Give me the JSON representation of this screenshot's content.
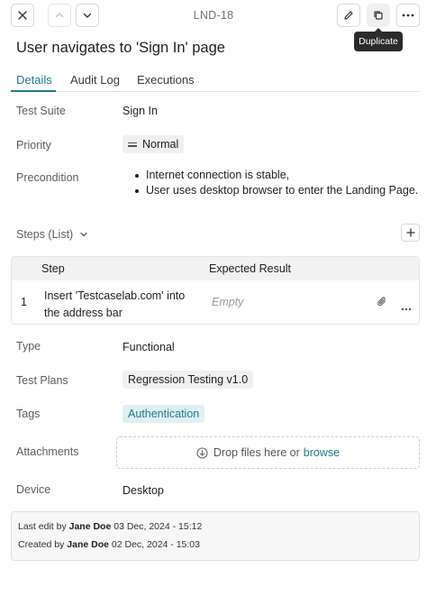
{
  "header": {
    "case_id": "LND-18",
    "tooltip": "Duplicate"
  },
  "title": "User navigates to 'Sign In' page",
  "tabs": [
    "Details",
    "Audit Log",
    "Executions"
  ],
  "fields": {
    "test_suite_label": "Test Suite",
    "test_suite_value": "Sign In",
    "priority_label": "Priority",
    "priority_value": "Normal",
    "precondition_label": "Precondition",
    "precondition_items": [
      "Internet connection is stable,",
      "User uses desktop browser to enter the Landing Page."
    ]
  },
  "steps": {
    "header": "Steps (List)",
    "columns": [
      "Step",
      "Expected Result"
    ],
    "rows": [
      {
        "num": "1",
        "step": "Insert 'Testcaselab.com' into the address bar",
        "expected": "Empty"
      }
    ]
  },
  "details": {
    "type_label": "Type",
    "type_value": "Functional",
    "test_plans_label": "Test Plans",
    "test_plans_value": "Regression Testing v1.0",
    "tags_label": "Tags",
    "tags_value": "Authentication",
    "attachments_label": "Attachments",
    "dropzone_text": "Drop files here or",
    "dropzone_link": "browse",
    "device_label": "Device",
    "device_value": "Desktop"
  },
  "footer": {
    "last_edit_prefix": "Last edit by",
    "last_edit_user": "Jane Doe",
    "last_edit_date": "03 Dec, 2024 - 15:12",
    "created_prefix": "Created by",
    "created_user": "Jane Doe",
    "created_date": "02 Dec, 2024 - 15:03"
  },
  "colors": {
    "accent": "#1f7a8c",
    "tag_bg": "#e0f0f3",
    "chip_bg": "#f0f0f0"
  },
  "icons": [
    "close-icon",
    "chevron-up-icon",
    "chevron-down-icon",
    "edit-icon",
    "duplicate-icon",
    "more-icon",
    "plus-icon",
    "paperclip-icon",
    "download-icon"
  ]
}
